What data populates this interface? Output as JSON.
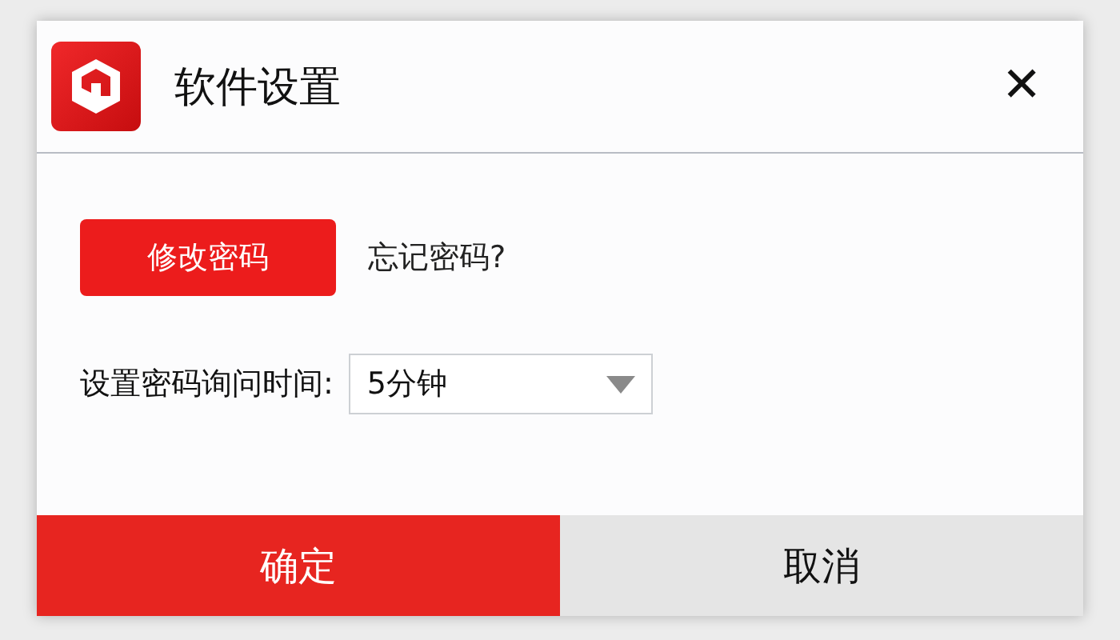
{
  "window": {
    "title": "软件设置",
    "close": "✕"
  },
  "password": {
    "change_button": "修改密码",
    "forgot_link": "忘记密码?"
  },
  "ask_interval": {
    "label": "设置密码询问时间:",
    "value": "5分钟"
  },
  "buttons": [
    {
      "label": "确定",
      "kind": "primary"
    },
    {
      "label": "取消",
      "kind": "secondary"
    }
  ]
}
